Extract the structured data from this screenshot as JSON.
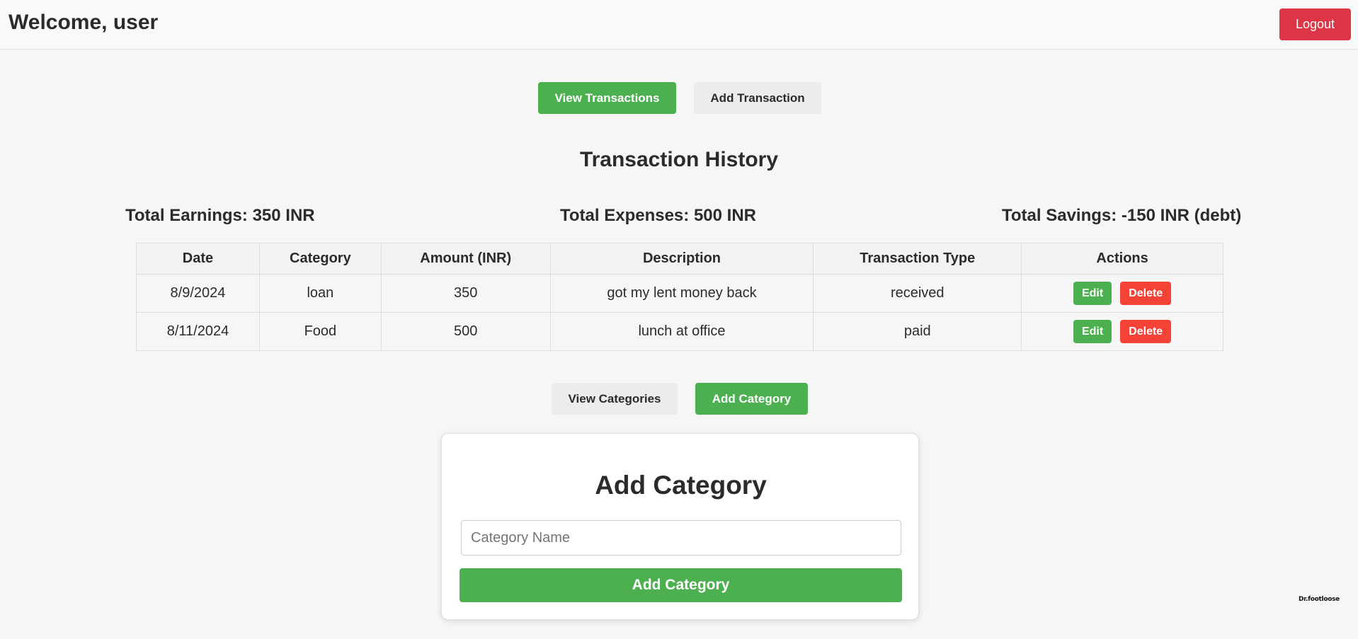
{
  "header": {
    "welcome": "Welcome, user",
    "logout_label": "Logout"
  },
  "transactions_nav": {
    "view_label": "View Transactions",
    "add_label": "Add Transaction"
  },
  "history": {
    "title": "Transaction History",
    "total_earnings": "Total Earnings: 350 INR",
    "total_expenses": "Total Expenses: 500 INR",
    "total_savings": "Total Savings: -150 INR (debt)"
  },
  "table": {
    "columns": [
      "Date",
      "Category",
      "Amount (INR)",
      "Description",
      "Transaction Type",
      "Actions"
    ],
    "rows": [
      {
        "date": "8/9/2024",
        "category": "loan",
        "amount": "350",
        "description": "got my lent money back",
        "type": "received",
        "edit": "Edit",
        "delete": "Delete"
      },
      {
        "date": "8/11/2024",
        "category": "Food",
        "amount": "500",
        "description": "lunch at office",
        "type": "paid",
        "edit": "Edit",
        "delete": "Delete"
      }
    ]
  },
  "categories_nav": {
    "view_label": "View Categories",
    "add_label": "Add Category"
  },
  "add_category_form": {
    "title": "Add Category",
    "input_placeholder": "Category Name",
    "input_value": "",
    "submit_label": "Add Category"
  },
  "watermark": "Dr.footloose",
  "colors": {
    "accent_green": "#4caf50",
    "logout_red": "#dc3545",
    "delete_red": "#f44336"
  }
}
